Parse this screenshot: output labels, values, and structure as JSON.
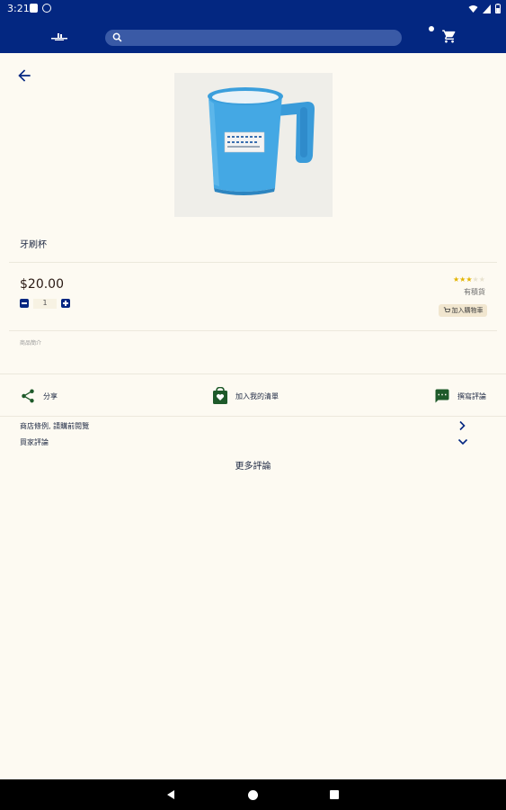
{
  "status_bar": {
    "time": "3:21"
  },
  "search": {
    "placeholder": "",
    "value": ""
  },
  "product": {
    "name": "牙刷杯",
    "price": "$20.00",
    "quantity": "1",
    "rating": 3,
    "rating_max": 5,
    "rating_label": "有積貨",
    "add_to_cart_label": "加入購物車",
    "intro_label": "商品簡介"
  },
  "actions": {
    "share_label": "分享",
    "wishlist_label": "加入我的清單",
    "review_label": "撰寫評論"
  },
  "rows": {
    "shop_policy_label": "商店條例, 請購前閱覽",
    "buyer_reviews_label": "買家評論"
  },
  "more_reviews_label": "更多評論",
  "colors": {
    "primary": "#032781",
    "background": "#fdfaf2",
    "star": "#e2b400",
    "action_icon": "#1e5a2a"
  }
}
